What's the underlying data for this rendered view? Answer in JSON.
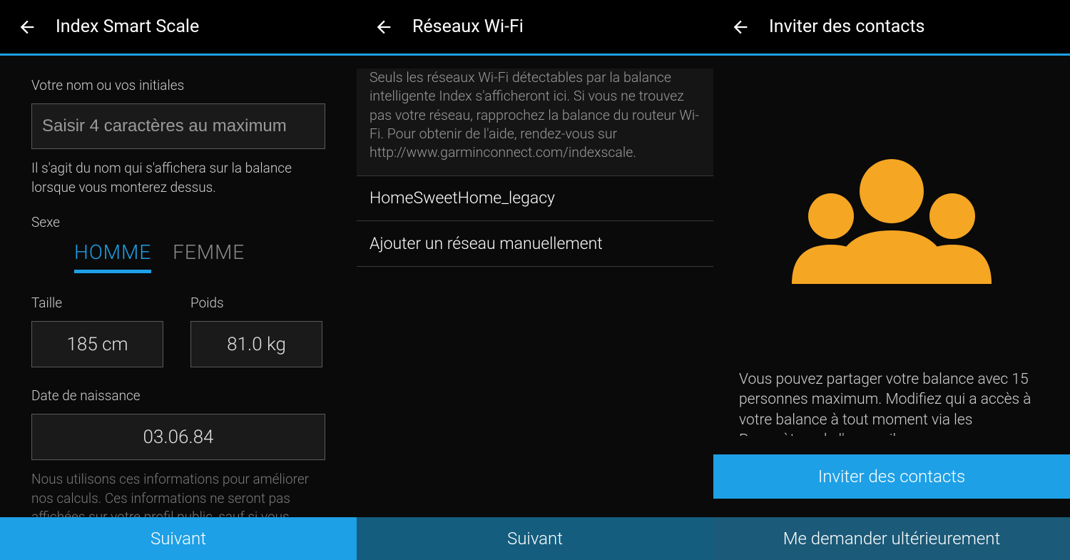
{
  "screen1": {
    "title": "Index Smart Scale",
    "nameLabel": "Votre nom ou vos initiales",
    "namePlaceholder": "Saisir 4 caractères au maximum",
    "nameHelper": "Il s'agit du nom qui s'affichera sur la balance lorsque vous monterez dessus.",
    "sexLabel": "Sexe",
    "sexOptions": {
      "male": "HOMME",
      "female": "FEMME"
    },
    "heightLabel": "Taille",
    "heightValue": "185 cm",
    "weightLabel": "Poids",
    "weightValue": "81.0 kg",
    "dobLabel": "Date de naissance",
    "dobValue": "03.06.84",
    "privacyNote": "Nous utilisons ces informations pour améliorer nos calculs. Ces informations ne seront pas affichées sur votre profil public, sauf si vous décidez de les montrer.",
    "next": "Suivant"
  },
  "screen2": {
    "title": "Réseaux Wi-Fi",
    "info": "Seuls les réseaux Wi-Fi détectables par la balance intelligente Index s'afficheront ici. Si vous ne trouvez pas votre réseau, rapprochez la balance du routeur Wi-Fi. Pour obtenir de l'aide, rendez-vous sur http://www.garminconnect.com/indexscale.",
    "networks": [
      "HomeSweetHome_legacy"
    ],
    "addManual": "Ajouter un réseau manuellement",
    "next": "Suivant"
  },
  "screen3": {
    "title": "Inviter des contacts",
    "shareText": "Vous pouvez partager votre balance avec 15 personnes maximum. Modifiez qui a accès à votre balance à tout moment via les Paramètres de l'appareil.",
    "inviteBtn": "Inviter des contacts",
    "laterBtn": "Me demander ultérieurement"
  }
}
